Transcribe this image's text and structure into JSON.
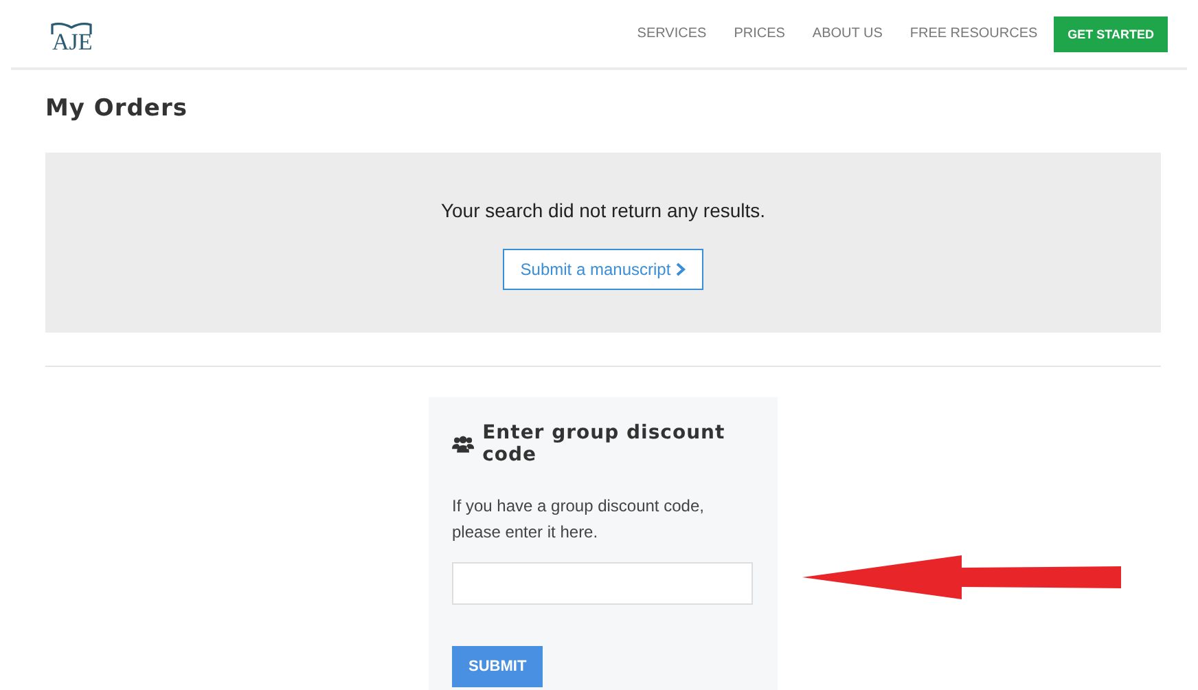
{
  "header": {
    "logo": "AJE",
    "nav": [
      {
        "label": "SERVICES"
      },
      {
        "label": "PRICES"
      },
      {
        "label": "ABOUT US"
      },
      {
        "label": "FREE RESOURCES"
      }
    ],
    "cta": "GET STARTED"
  },
  "page_title": "My Orders",
  "results": {
    "message": "Your search did not return any results.",
    "button": "Submit a manuscript"
  },
  "discount": {
    "title": "Enter group discount code",
    "text": "If you have a group discount code, please enter it here.",
    "button": "SUBMIT"
  }
}
